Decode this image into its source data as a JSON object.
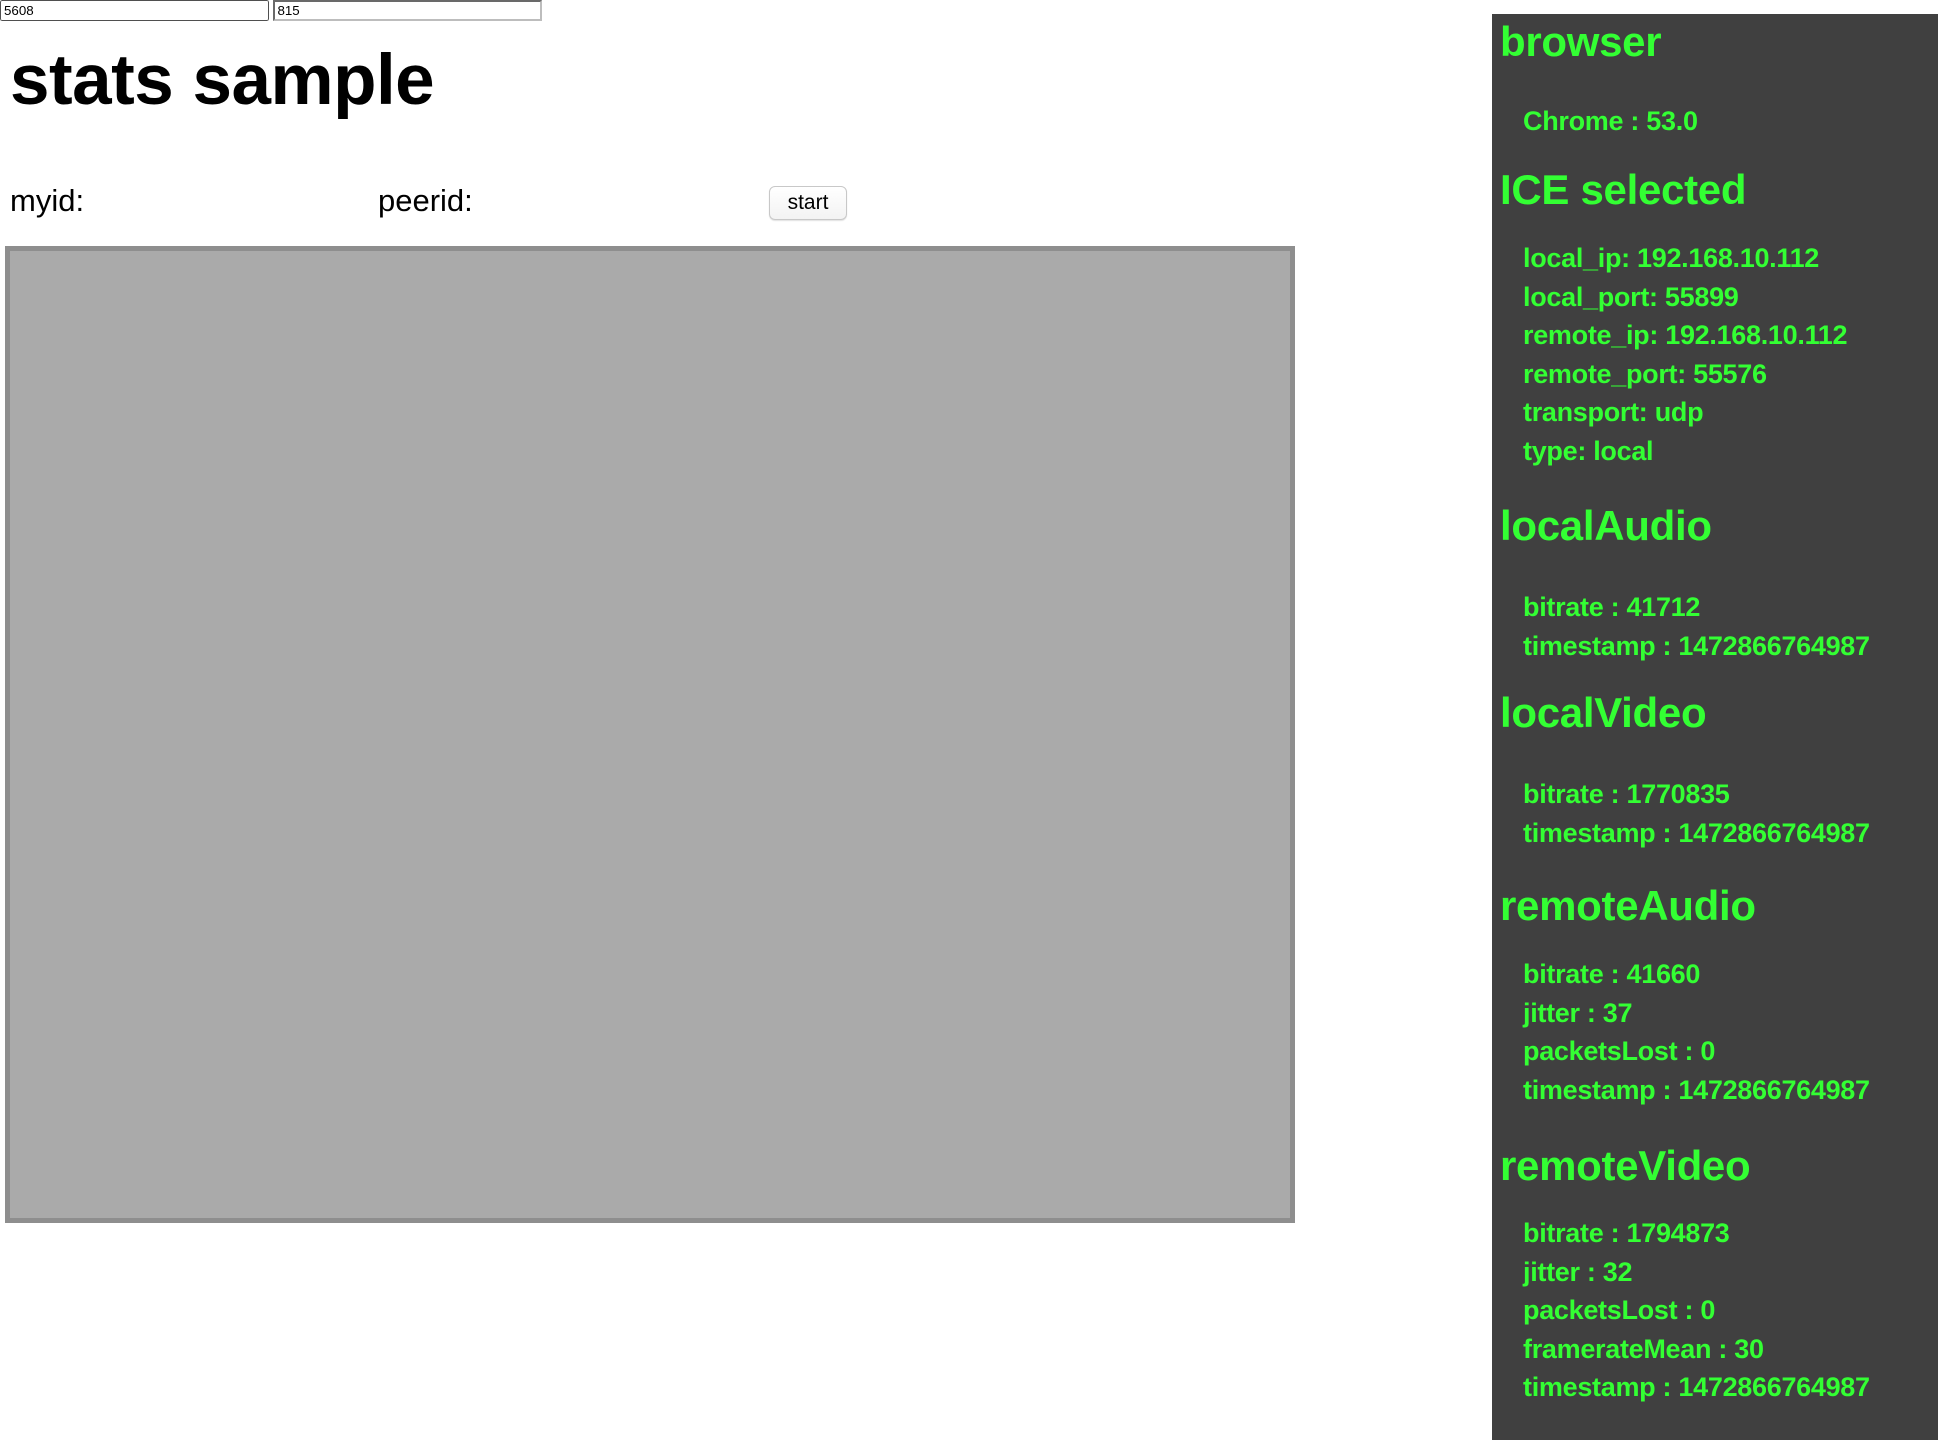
{
  "page": {
    "title": "stats sample"
  },
  "form": {
    "myid_label": "myid:",
    "myid_value": "5608",
    "peerid_label": "peerid:",
    "peerid_value": "815",
    "start_label": "start"
  },
  "colors": {
    "panel_background": "#404040",
    "panel_text": "#33ff33",
    "video_background": "#aaaaaa",
    "video_border": "#8e8e8e"
  },
  "stats": {
    "browser": {
      "heading": "browser",
      "items": [
        "Chrome : 53.0"
      ]
    },
    "ice_selected": {
      "heading": "ICE selected",
      "items": [
        "local_ip: 192.168.10.112",
        "local_port: 55899",
        "remote_ip: 192.168.10.112",
        "remote_port: 55576",
        "transport: udp",
        "type: local"
      ]
    },
    "local_audio": {
      "heading": "localAudio",
      "items": [
        "bitrate : 41712",
        "timestamp : 1472866764987"
      ]
    },
    "local_video": {
      "heading": "localVideo",
      "items": [
        "bitrate : 1770835",
        "timestamp : 1472866764987"
      ]
    },
    "remote_audio": {
      "heading": "remoteAudio",
      "items": [
        "bitrate : 41660",
        "jitter : 37",
        "packetsLost : 0",
        "timestamp : 1472866764987"
      ]
    },
    "remote_video": {
      "heading": "remoteVideo",
      "items": [
        "bitrate : 1794873",
        "jitter : 32",
        "packetsLost : 0",
        "framerateMean : 30",
        "timestamp : 1472866764987"
      ]
    }
  }
}
